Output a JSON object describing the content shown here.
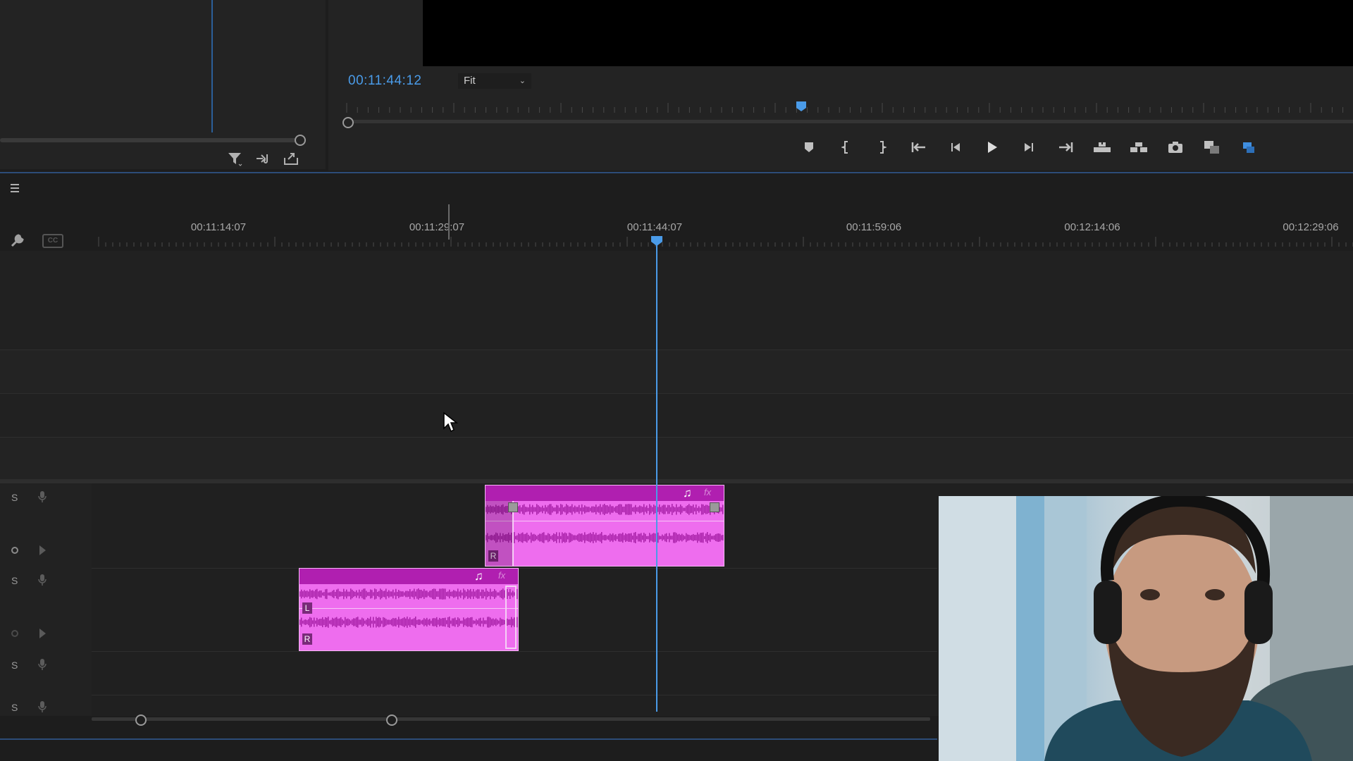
{
  "program_monitor": {
    "timecode": "00:11:44:12",
    "fit_select": {
      "value": "Fit"
    }
  },
  "source_panel": {
    "tools": [
      "filter-icon",
      "insert-audio-icon",
      "export-icon"
    ]
  },
  "transport": [
    "add-marker-icon",
    "mark-in-icon",
    "mark-out-icon",
    "go-to-in-icon",
    "step-back-icon",
    "play-icon",
    "step-forward-icon",
    "go-to-out-icon",
    "lift-icon",
    "extract-icon",
    "export-frame-icon",
    "comparison-view-icon",
    "button-editor-icon"
  ],
  "timeline": {
    "ruler_labels": [
      "00:11:14:07",
      "00:11:29:07",
      "00:11:44:07",
      "00:11:59:06",
      "00:12:14:06",
      "00:12:29:06"
    ],
    "track_headers": [
      "S",
      "S",
      "S",
      "S"
    ],
    "clip_labels": {
      "left": "L",
      "right": "R"
    }
  },
  "colors": {
    "accent": "#4a9be8",
    "audio_clip": "#ee6dee",
    "audio_clip_header": "#b01fb0"
  }
}
